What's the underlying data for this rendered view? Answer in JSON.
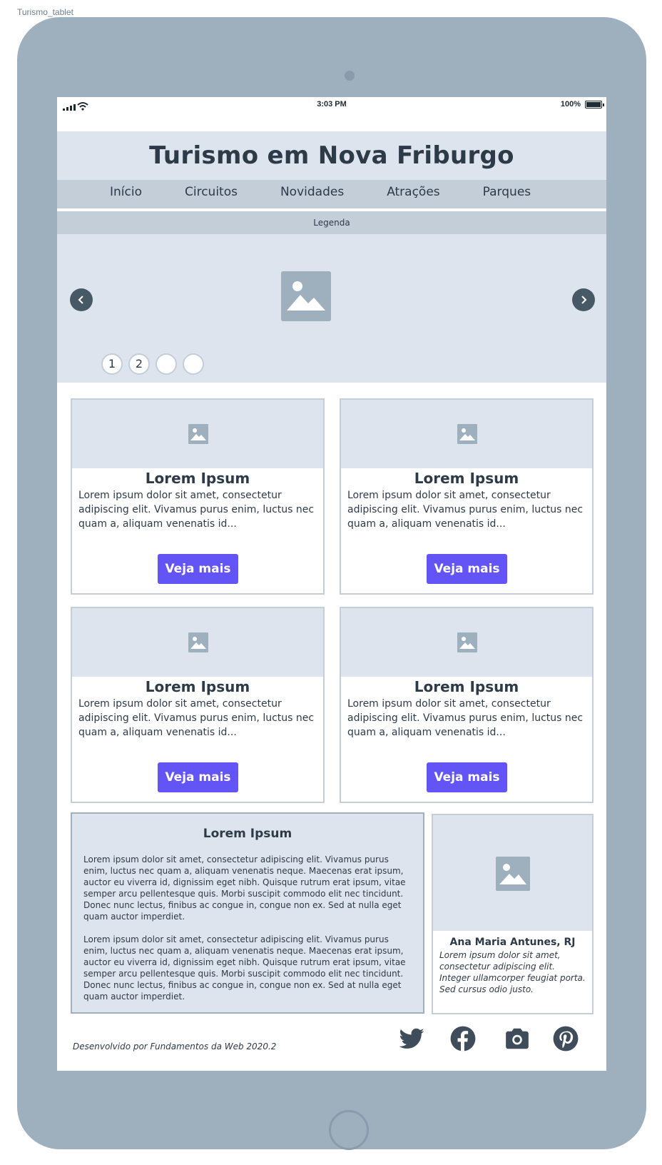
{
  "frame": {
    "label": "Turismo_tablet"
  },
  "status_bar": {
    "time": "3:03 PM",
    "battery": "100%"
  },
  "header": {
    "title": "Turismo em Nova Friburgo"
  },
  "nav": {
    "items": [
      "Início",
      "Circuitos",
      "Novidades",
      "Atrações",
      "Parques"
    ]
  },
  "carousel": {
    "caption": "Legenda",
    "dots": [
      "1",
      "2",
      "",
      ""
    ],
    "icons": {
      "prev": "chevron-left-icon",
      "next": "chevron-right-icon",
      "image": "image-placeholder-icon"
    }
  },
  "cards": [
    {
      "title": "Lorem Ipsum",
      "text": "Lorem ipsum dolor sit amet, consectetur adipiscing elit. Vivamus purus enim, luctus nec quam a, aliquam venenatis id...",
      "button": "Veja mais"
    },
    {
      "title": "Lorem Ipsum",
      "text": "Lorem ipsum dolor sit amet, consectetur adipiscing elit. Vivamus purus enim, luctus nec quam a, aliquam venenatis id...",
      "button": "Veja mais"
    },
    {
      "title": "Lorem Ipsum",
      "text": "Lorem ipsum dolor sit amet, consectetur adipiscing elit. Vivamus purus enim, luctus nec quam a, aliquam venenatis id...",
      "button": "Veja mais"
    },
    {
      "title": "Lorem Ipsum",
      "text": "Lorem ipsum dolor sit amet, consectetur adipiscing elit. Vivamus purus enim, luctus nec quam a, aliquam venenatis id...",
      "button": "Veja mais"
    }
  ],
  "article": {
    "title": "Lorem Ipsum",
    "paragraphs": [
      "Lorem ipsum dolor sit amet, consectetur adipiscing elit. Vivamus purus enim, luctus nec quam a, aliquam venenatis neque. Maecenas erat ipsum, auctor eu viverra id, dignissim eget nibh. Quisque rutrum erat ipsum, vitae semper arcu pellentesque quis. Morbi suscipit commodo elit nec tincidunt. Donec nunc lectus, finibus ac congue in, congue non ex. Sed at nulla eget quam auctor imperdiet.",
      "Lorem ipsum dolor sit amet, consectetur adipiscing elit. Vivamus purus enim, luctus nec quam a, aliquam venenatis neque. Maecenas erat ipsum, auctor eu viverra id, dignissim eget nibh. Quisque rutrum erat ipsum, vitae semper arcu pellentesque quis. Morbi suscipit commodo elit nec tincidunt. Donec nunc lectus, finibus ac congue in, congue non ex. Sed at nulla eget quam auctor imperdiet."
    ]
  },
  "testimonial": {
    "name": "Ana Maria Antunes, RJ",
    "quote": "Lorem ipsum dolor sit amet, consectetur adipiscing elit. Integer ullamcorper feugiat porta. Sed cursus odio justo."
  },
  "footer": {
    "credit": "Desenvolvido por Fundamentos da Web 2020.2",
    "social": [
      "twitter-icon",
      "facebook-icon",
      "camera-icon",
      "pinterest-icon"
    ]
  },
  "colors": {
    "device": "#9eafbd",
    "header_bg": "#dee4ed",
    "nav_bg": "#c3ced9",
    "button": "#6355f5",
    "text": "#2d3a47",
    "carousel_arrow": "#485966"
  }
}
